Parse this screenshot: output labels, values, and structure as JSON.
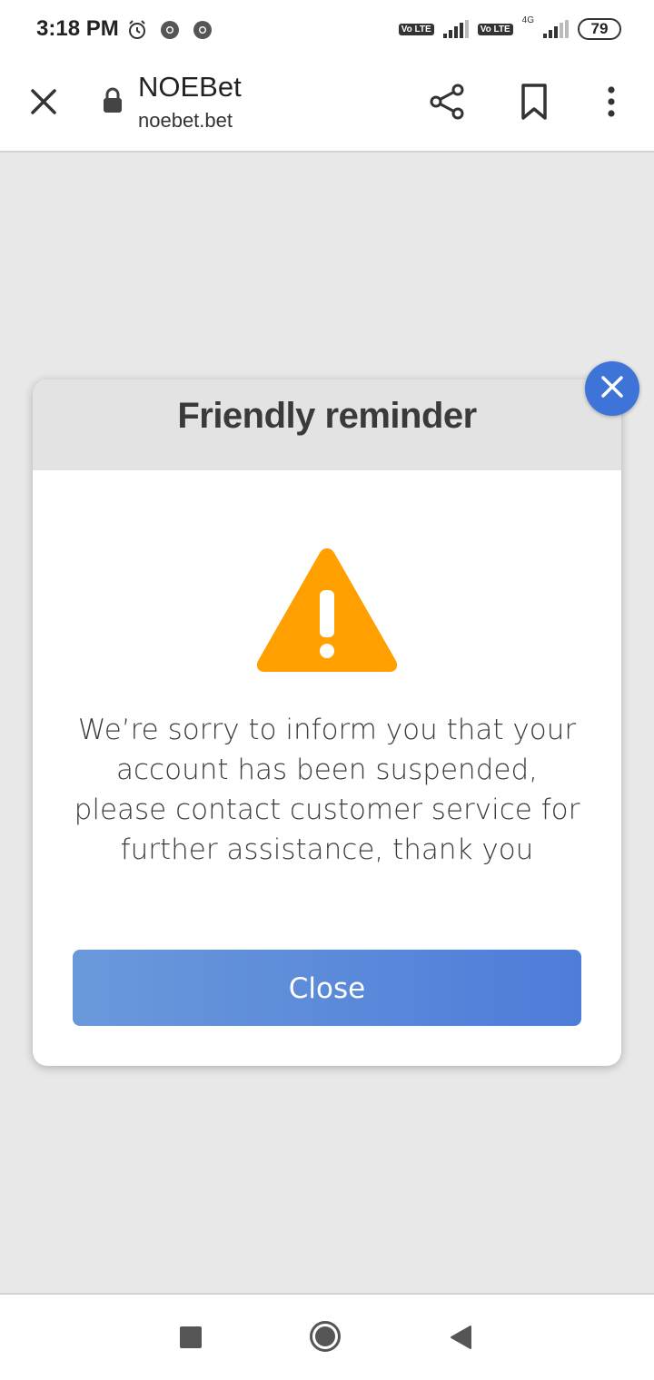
{
  "status_bar": {
    "time": "3:18 PM",
    "left_icons": [
      "alarm-icon",
      "chrome-icon",
      "chrome-icon"
    ],
    "sim1_label": "Vo LTE",
    "sim2_label": "Vo LTE",
    "network_type": "4G",
    "battery": "79"
  },
  "browser": {
    "site_title": "NOEBet",
    "site_url": "noebet.bet",
    "icons": [
      "close-icon",
      "lock-icon",
      "share-icon",
      "bookmark-icon",
      "more-vert-icon"
    ]
  },
  "dialog": {
    "title": "Friendly reminder",
    "message": "We’re sorry to inform you that your account has been suspended, please contact customer service for further assistance, thank you",
    "close_button_label": "Close",
    "warning_icon": "warning-icon",
    "accent_color": "#4e7cd9",
    "warning_color": "#ffa000"
  },
  "nav_bar": {
    "icons": [
      "recents-icon",
      "home-icon",
      "back-icon"
    ]
  }
}
